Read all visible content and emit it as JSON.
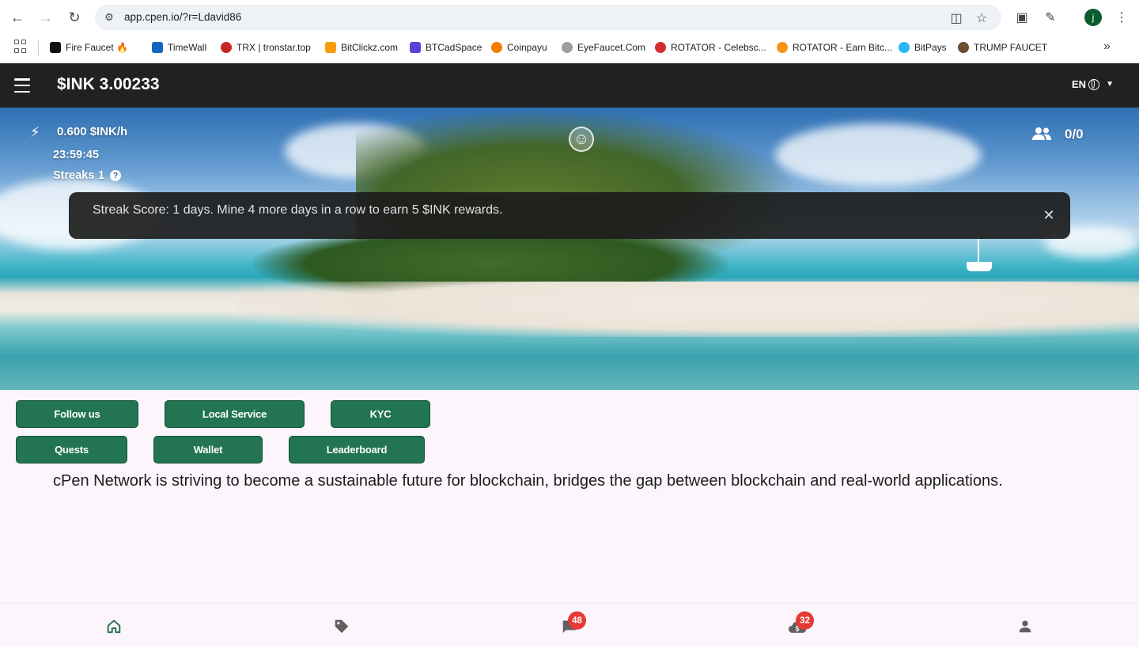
{
  "browser": {
    "url": "app.cpen.io/?r=Ldavid86",
    "profile_initial": "j",
    "bookmarks": [
      {
        "label": "Fire Faucet 🔥",
        "prefix": "🔥",
        "color": "#111111"
      },
      {
        "label": "TimeWall",
        "color": "#1565c0"
      },
      {
        "label": "TRX | tronstar.top",
        "color": "#c62828"
      },
      {
        "label": "BitClickz.com",
        "color": "#f59e0b"
      },
      {
        "label": "BTCadSpace",
        "color": "#5b3fd6"
      },
      {
        "label": "Coinpayu",
        "color": "#f57c00"
      },
      {
        "label": "EyeFaucet.Com",
        "color": "#9e9e9e"
      },
      {
        "label": "ROTATOR - Celebsc...",
        "color": "#d32f2f"
      },
      {
        "label": "ROTATOR - Earn Bitc...",
        "color": "#f7931a"
      },
      {
        "label": "BitPays",
        "color": "#29b6f6"
      },
      {
        "label": "TRUMP FAUCET",
        "color": "#6d4c2f"
      }
    ]
  },
  "header": {
    "balance": "$INK 3.00233",
    "language": "EN"
  },
  "hero": {
    "rate": "0.600 $INK/h",
    "timer": "23:59:45",
    "streaks_label": "Streaks",
    "streaks_value": "1",
    "referrals": "0/0",
    "toast": "Streak Score: 1 days. Mine 4 more days in a row to earn 5 $INK rewards."
  },
  "actions": {
    "follow_us": "Follow us",
    "local_service": "Local Service",
    "kyc": "KYC",
    "quests": "Quests",
    "wallet": "Wallet",
    "leaderboard": "Leaderboard"
  },
  "description": "cPen Network is striving to become a sustainable future for blockchain, bridges the gap between blockchain and real-world applications.",
  "bottom_nav": {
    "chat_badge": "48",
    "rewards_badge": "32"
  },
  "colors": {
    "primary_button": "#227452",
    "header_bg": "#212121",
    "badge": "#e53935"
  }
}
